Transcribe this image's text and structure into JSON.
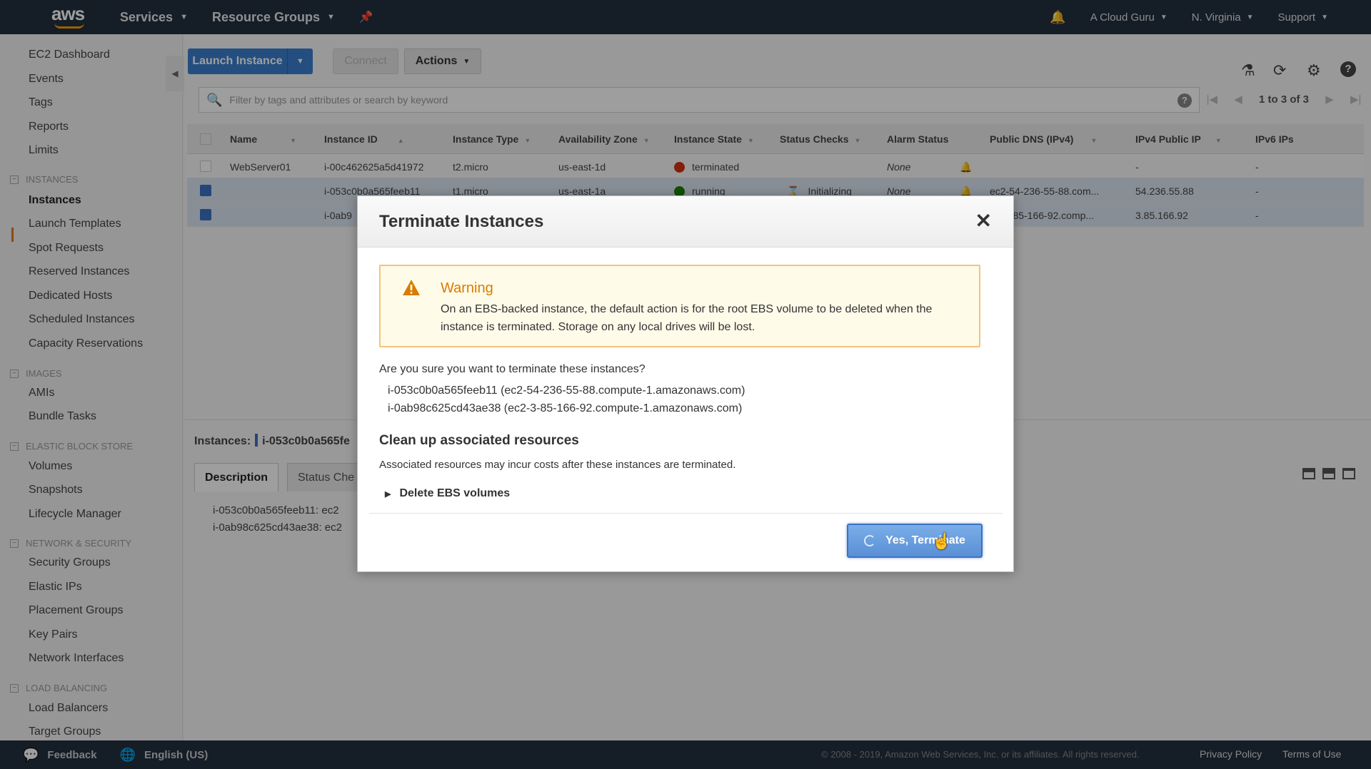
{
  "topnav": {
    "logo": "aws",
    "services": "Services",
    "resource_groups": "Resource Groups",
    "account": "A Cloud Guru",
    "region": "N. Virginia",
    "support": "Support"
  },
  "sidebar": {
    "items": [
      {
        "label": "EC2 Dashboard"
      },
      {
        "label": "Events"
      },
      {
        "label": "Tags"
      },
      {
        "label": "Reports"
      },
      {
        "label": "Limits"
      }
    ],
    "sections": [
      {
        "title": "INSTANCES",
        "items": [
          "Instances",
          "Launch Templates",
          "Spot Requests",
          "Reserved Instances",
          "Dedicated Hosts",
          "Scheduled Instances",
          "Capacity Reservations"
        ]
      },
      {
        "title": "IMAGES",
        "items": [
          "AMIs",
          "Bundle Tasks"
        ]
      },
      {
        "title": "ELASTIC BLOCK STORE",
        "items": [
          "Volumes",
          "Snapshots",
          "Lifecycle Manager"
        ]
      },
      {
        "title": "NETWORK & SECURITY",
        "items": [
          "Security Groups",
          "Elastic IPs",
          "Placement Groups",
          "Key Pairs",
          "Network Interfaces"
        ]
      },
      {
        "title": "LOAD BALANCING",
        "items": [
          "Load Balancers",
          "Target Groups"
        ]
      }
    ]
  },
  "toolbar": {
    "launch_label": "Launch Instance",
    "connect_label": "Connect",
    "actions_label": "Actions"
  },
  "filter": {
    "placeholder": "Filter by tags and attributes or search by keyword",
    "pager": "1 to 3 of 3"
  },
  "table": {
    "columns": [
      "Name",
      "Instance ID",
      "Instance Type",
      "Availability Zone",
      "Instance State",
      "Status Checks",
      "Alarm Status",
      "Public DNS (IPv4)",
      "IPv4 Public IP",
      "IPv6 IPs"
    ],
    "rows": [
      {
        "name": "WebServer01",
        "id": "i-00c462625a5d41972",
        "type": "t2.micro",
        "az": "us-east-1d",
        "state": "terminated",
        "status": "",
        "alarm": "None",
        "dns": "",
        "ip": "-",
        "ipv6": "-"
      },
      {
        "name": "",
        "id": "i-053c0b0a565feeb11",
        "type": "t1.micro",
        "az": "us-east-1a",
        "state": "running",
        "status": "Initializing",
        "alarm": "None",
        "dns": "ec2-54-236-55-88.com...",
        "ip": "54.236.55.88",
        "ipv6": "-"
      },
      {
        "name": "",
        "id": "i-0ab9",
        "type": "",
        "az": "",
        "state": "",
        "status": "",
        "alarm": "",
        "dns": "3-85-166-92.comp...",
        "ip": "3.85.166.92",
        "ipv6": "-"
      }
    ]
  },
  "lower": {
    "instances_label": "Instances:",
    "instances_value": "i-053c0b0a565fe",
    "tabs": [
      "Description",
      "Status Che"
    ],
    "lines": [
      "i-053c0b0a565feeb11: ec2",
      "i-0ab98c625cd43ae38: ec2"
    ]
  },
  "modal": {
    "title": "Terminate Instances",
    "close": "✕",
    "warning_title": "Warning",
    "warning_body": "On an EBS-backed instance, the default action is for the root EBS volume to be deleted when the instance is terminated. Storage on any local drives will be lost.",
    "question": "Are you sure you want to terminate these instances?",
    "instances": [
      "i-053c0b0a565feeb11 (ec2-54-236-55-88.compute-1.amazonaws.com)",
      "i-0ab98c625cd43ae38 (ec2-3-85-166-92.compute-1.amazonaws.com)"
    ],
    "cleanup_title": "Clean up associated resources",
    "cleanup_note": "Associated resources may incur costs after these instances are terminated.",
    "delete_ebs": "Delete EBS volumes",
    "confirm": "Yes, Terminate"
  },
  "footer": {
    "feedback": "Feedback",
    "language": "English (US)",
    "copyright": "© 2008 - 2019, Amazon Web Services, Inc. or its affiliates. All rights reserved.",
    "privacy": "Privacy Policy",
    "terms": "Terms of Use"
  },
  "colors": {
    "nav_bg": "#232f3e",
    "primary_blue": "#3b7ecf",
    "warning_orange": "#d97b00",
    "terminated_red": "#d13212",
    "running_green": "#1d8102"
  }
}
